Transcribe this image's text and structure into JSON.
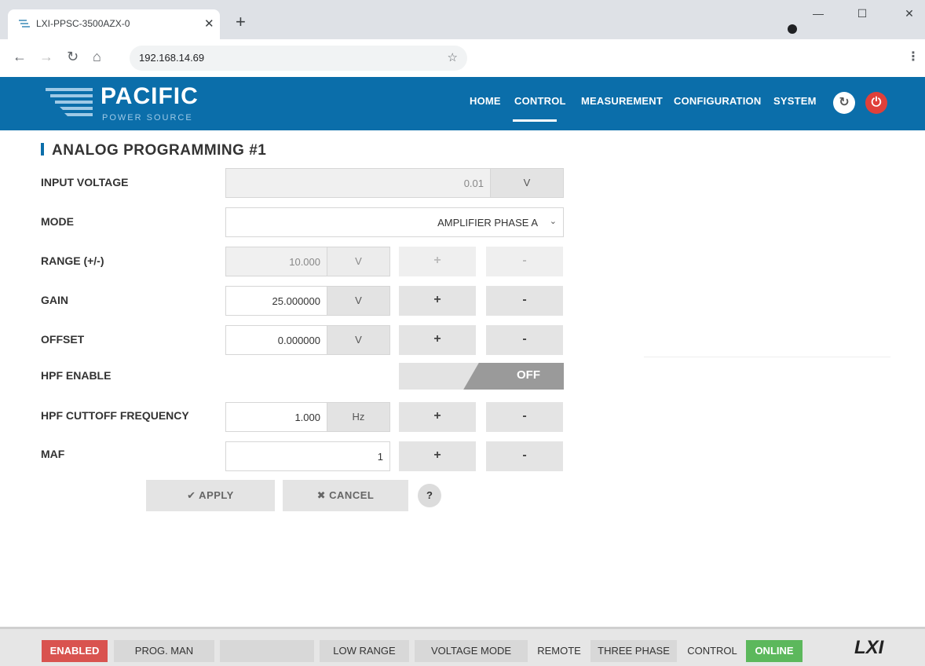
{
  "browser": {
    "tab_title": "LXI-PPSC-3500AZX-0",
    "url": "192.168.14.69"
  },
  "brand": {
    "name": "PACIFIC",
    "sub": "POWER SOURCE"
  },
  "nav": {
    "items": [
      "HOME",
      "CONTROL",
      "MEASUREMENT",
      "CONFIGURATION",
      "SYSTEM"
    ],
    "active": "CONTROL"
  },
  "section": {
    "title": "ANALOG PROGRAMMING #1"
  },
  "form": {
    "input_voltage": {
      "label": "INPUT VOLTAGE",
      "value": "0.01",
      "unit": "V"
    },
    "mode": {
      "label": "MODE",
      "value": "AMPLIFIER PHASE A"
    },
    "range": {
      "label": "RANGE (+/-)",
      "value": "10.000",
      "unit": "V",
      "plus": "+",
      "minus": "-"
    },
    "gain": {
      "label": "GAIN",
      "value": "25.000000",
      "unit": "V",
      "plus": "+",
      "minus": "-"
    },
    "offset": {
      "label": "OFFSET",
      "value": "0.000000",
      "unit": "V",
      "plus": "+",
      "minus": "-"
    },
    "hpf_enable": {
      "label": "HPF ENABLE",
      "state": "OFF"
    },
    "hpf_cutoff": {
      "label": "HPF CUTTOFF FREQUENCY",
      "value": "1.000",
      "unit": "Hz",
      "plus": "+",
      "minus": "-"
    },
    "maf": {
      "label": "MAF",
      "value": "1",
      "plus": "+",
      "minus": "-"
    }
  },
  "actions": {
    "apply": "✔ APPLY",
    "cancel": "✖ CANCEL",
    "help": "?"
  },
  "status": {
    "enabled": "ENABLED",
    "prog": "PROG. MAN",
    "blank": "",
    "range": "LOW RANGE",
    "mode": "VOLTAGE MODE",
    "remote": "REMOTE",
    "phase": "THREE PHASE",
    "control": "CONTROL",
    "online": "ONLINE",
    "lxi": "LXI"
  },
  "colors": {
    "brand_blue": "#0b6eaa",
    "enabled_red": "#d9534f",
    "online_green": "#5cb85c"
  }
}
